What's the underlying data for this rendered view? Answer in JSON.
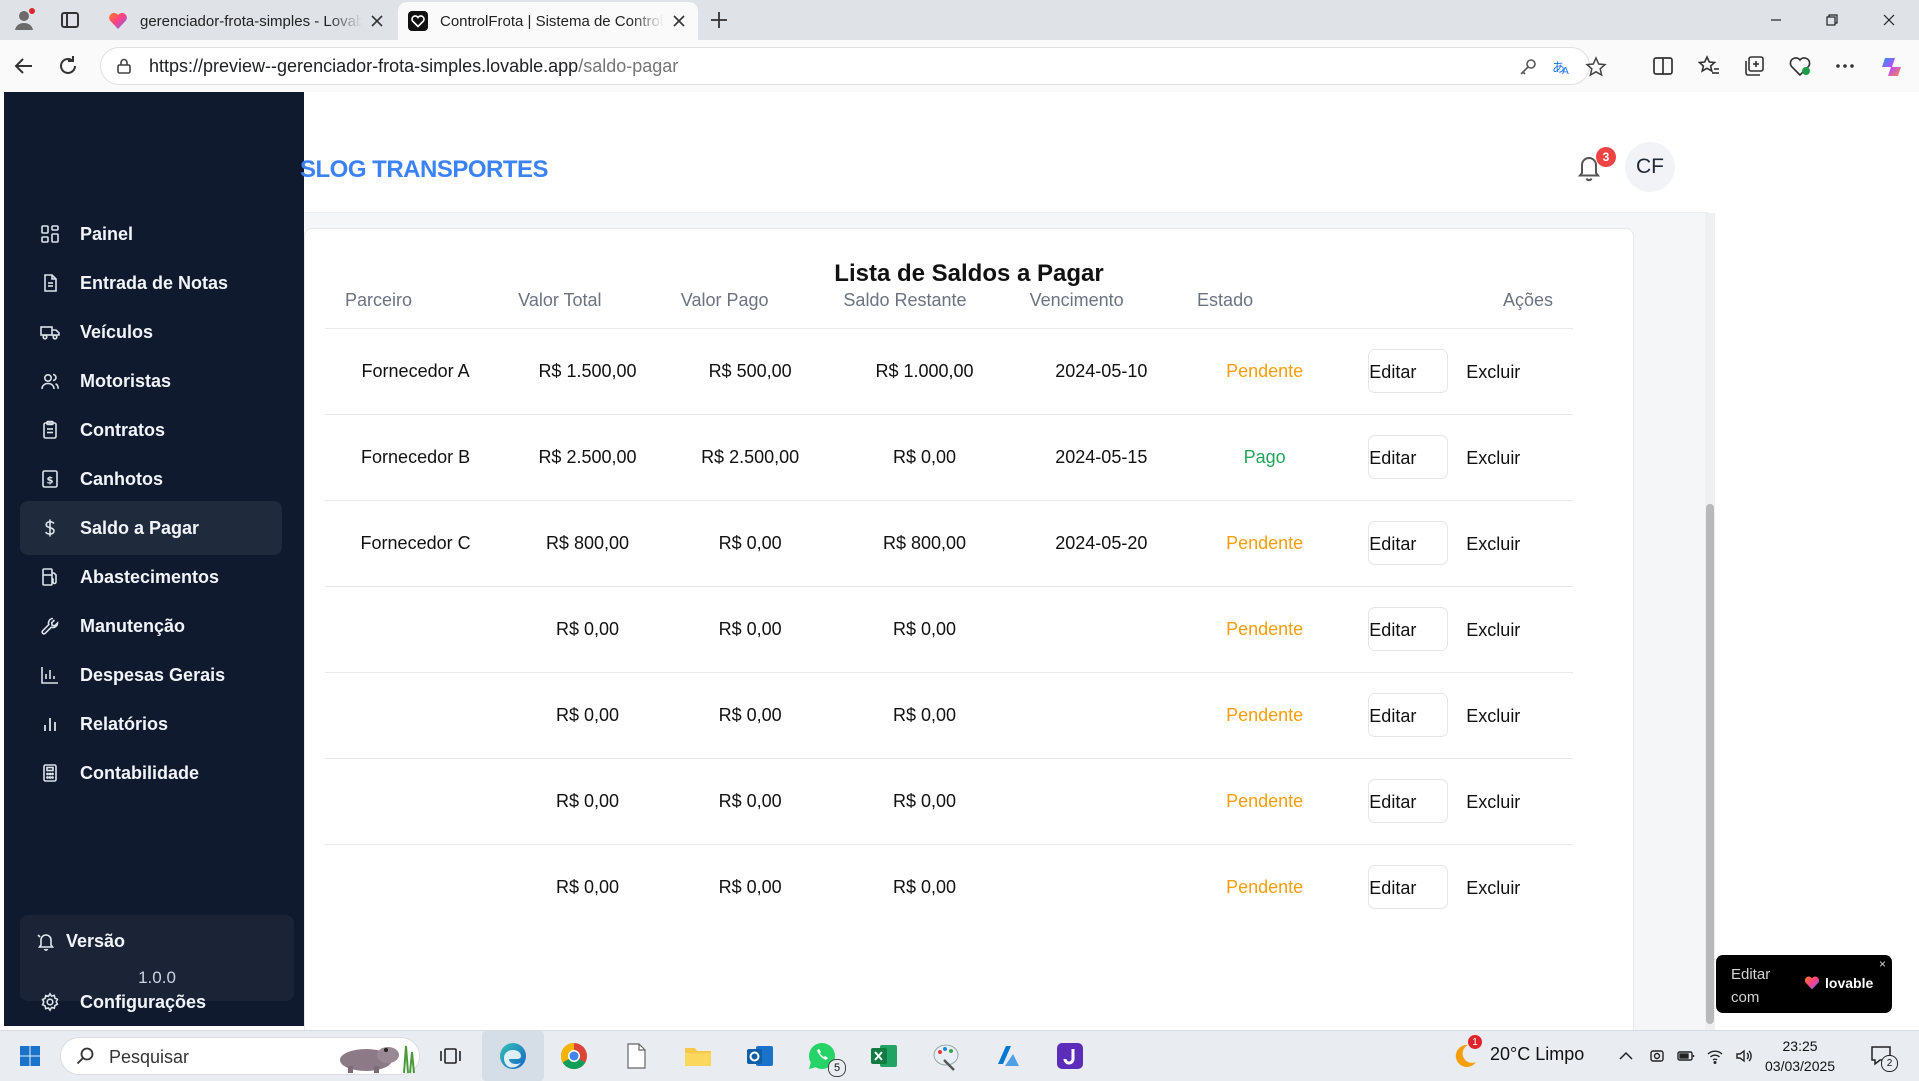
{
  "browser": {
    "tabs": [
      {
        "title": "gerenciador-frota-simples - Lovable",
        "active": false
      },
      {
        "title": "ControlFrota | Sistema de Controle",
        "active": true
      }
    ],
    "url_host": "https://preview--gerenciador-frota-simples.lovable.app",
    "url_path": "/saldo-pagar"
  },
  "header": {
    "brand": "SLOG TRANSPORTES",
    "notifications_count": "3",
    "avatar_initials": "CF"
  },
  "sidebar": {
    "items": [
      {
        "label": "Painel",
        "icon": "dashboard-icon",
        "active": false
      },
      {
        "label": "Entrada de Notas",
        "icon": "document-icon",
        "active": false
      },
      {
        "label": "Veículos",
        "icon": "truck-icon",
        "active": false
      },
      {
        "label": "Motoristas",
        "icon": "users-icon",
        "active": false
      },
      {
        "label": "Contratos",
        "icon": "clipboard-icon",
        "active": false
      },
      {
        "label": "Canhotos",
        "icon": "receipt-icon",
        "active": false
      },
      {
        "label": "Saldo a Pagar",
        "icon": "dollar-icon",
        "active": true
      },
      {
        "label": "Abastecimentos",
        "icon": "fuel-icon",
        "active": false
      },
      {
        "label": "Manutenção",
        "icon": "wrench-icon",
        "active": false
      },
      {
        "label": "Despesas Gerais",
        "icon": "bar-chart-icon",
        "active": false
      },
      {
        "label": "Relatórios",
        "icon": "chart-icon",
        "active": false
      },
      {
        "label": "Contabilidade",
        "icon": "calculator-icon",
        "active": false
      },
      {
        "label": "Configurações",
        "icon": "gear-icon",
        "active": false
      }
    ],
    "version_label": "Versão",
    "version_number": "1.0.0"
  },
  "main": {
    "title": "Lista de Saldos a Pagar",
    "columns": [
      "Parceiro",
      "Valor Total",
      "Valor Pago",
      "Saldo Restante",
      "Vencimento",
      "Estado",
      "Ações"
    ],
    "rows": [
      {
        "parceiro": "Fornecedor A",
        "total": "R$ 1.500,00",
        "pago": "R$ 500,00",
        "restante": "R$ 1.000,00",
        "vencimento": "2024-05-10",
        "estado": "Pendente"
      },
      {
        "parceiro": "Fornecedor B",
        "total": "R$ 2.500,00",
        "pago": "R$ 2.500,00",
        "restante": "R$ 0,00",
        "vencimento": "2024-05-15",
        "estado": "Pago"
      },
      {
        "parceiro": "Fornecedor C",
        "total": "R$ 800,00",
        "pago": "R$ 0,00",
        "restante": "R$ 800,00",
        "vencimento": "2024-05-20",
        "estado": "Pendente"
      },
      {
        "parceiro": "",
        "total": "R$ 0,00",
        "pago": "R$ 0,00",
        "restante": "R$ 0,00",
        "vencimento": "",
        "estado": "Pendente"
      },
      {
        "parceiro": "",
        "total": "R$ 0,00",
        "pago": "R$ 0,00",
        "restante": "R$ 0,00",
        "vencimento": "",
        "estado": "Pendente"
      },
      {
        "parceiro": "",
        "total": "R$ 0,00",
        "pago": "R$ 0,00",
        "restante": "R$ 0,00",
        "vencimento": "",
        "estado": "Pendente"
      },
      {
        "parceiro": "",
        "total": "R$ 0,00",
        "pago": "R$ 0,00",
        "restante": "R$ 0,00",
        "vencimento": "",
        "estado": "Pendente"
      }
    ],
    "edit_label": "Editar",
    "delete_label": "Excluir"
  },
  "lovable_badge": {
    "label": "Editar com",
    "brand": "lovable",
    "close": "×"
  },
  "taskbar": {
    "search_placeholder": "Pesquisar",
    "whatsapp_badge": "5",
    "weather_badge": "1",
    "weather": "20°C  Limpo",
    "time": "23:25",
    "date": "03/03/2025",
    "notification_count": "2"
  },
  "colors": {
    "sidebar_bg": "#0f1a2e",
    "brand_blue": "#3b82f6",
    "pending": "#f59e0b",
    "paid": "#22a55a",
    "badge_red": "#ef4444"
  }
}
